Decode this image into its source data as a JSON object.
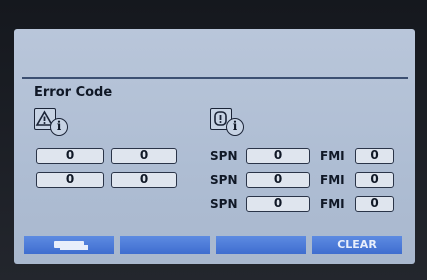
{
  "section_title": "Error Code",
  "icons": {
    "warning": "warning-info-icon",
    "engine": "engine-info-icon",
    "info_glyph": "i"
  },
  "codes_left": [
    [
      "0",
      "0"
    ],
    [
      "0",
      "0"
    ]
  ],
  "diagnostics": {
    "spn_label": "SPN",
    "fmi_label": "FMI",
    "rows": [
      {
        "spn": "0",
        "fmi": "0"
      },
      {
        "spn": "0",
        "fmi": "0"
      },
      {
        "spn": "0",
        "fmi": "0"
      }
    ]
  },
  "softkeys": [
    {
      "label": "",
      "icon": "keyboard-icon"
    },
    {
      "label": ""
    },
    {
      "label": ""
    },
    {
      "label": "CLEAR"
    }
  ],
  "colors": {
    "screen": "#b0bfd5",
    "softkey": "#4a78d8",
    "divider": "#3c4f72"
  }
}
